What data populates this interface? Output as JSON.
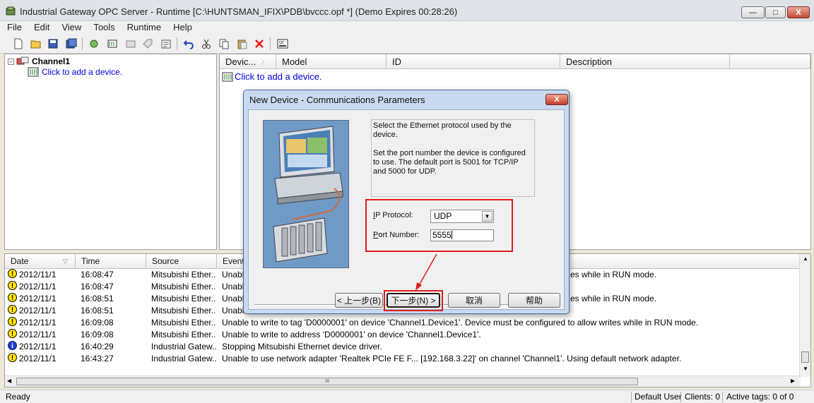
{
  "window": {
    "title": "Industrial Gateway OPC Server - Runtime [C:\\HUNTSMAN_IFIX\\PDB\\bvccc.opf *] (Demo Expires 00:28:26)",
    "min": "—",
    "max": "□",
    "close": "X"
  },
  "menu": [
    "File",
    "Edit",
    "View",
    "Tools",
    "Runtime",
    "Help"
  ],
  "tree": {
    "expander": "−",
    "channel": "Channel1",
    "add_device": "Click to add a device."
  },
  "devices": {
    "columns": [
      "Devic...",
      "Model",
      "ID",
      "Description"
    ],
    "add_device": "Click to add a device."
  },
  "log": {
    "columns": [
      "Date",
      "Time",
      "Source",
      "Event"
    ],
    "rows": [
      {
        "type": "warning",
        "date": "2012/11/1",
        "time": "16:08:47",
        "source": "Mitsubishi Ether...",
        "event": "Unable",
        "event_tail": "es while in RUN mode."
      },
      {
        "type": "warning",
        "date": "2012/11/1",
        "time": "16:08:47",
        "source": "Mitsubishi Ether...",
        "event": "Unable",
        "event_tail": ""
      },
      {
        "type": "warning",
        "date": "2012/11/1",
        "time": "16:08:51",
        "source": "Mitsubishi Ether...",
        "event": "Unable",
        "event_tail": "es while in RUN mode."
      },
      {
        "type": "warning",
        "date": "2012/11/1",
        "time": "16:08:51",
        "source": "Mitsubishi Ether...",
        "event": "Unable",
        "event_tail": ""
      },
      {
        "type": "warning",
        "date": "2012/11/1",
        "time": "16:09:08",
        "source": "Mitsubishi Ether...",
        "event": "Unable to write to tag 'D0000001' on device 'Channel1.Device1'. Device must be configured to allow writes while in RUN mode.",
        "event_tail": ""
      },
      {
        "type": "warning",
        "date": "2012/11/1",
        "time": "16:09:08",
        "source": "Mitsubishi Ether...",
        "event": "Unable to write to address 'D0000001' on device 'Channel1.Device1'.",
        "event_tail": ""
      },
      {
        "type": "info",
        "date": "2012/11/1",
        "time": "16:40:29",
        "source": "Industrial Gatew...",
        "event": "Stopping Mitsubishi Ethernet device driver.",
        "event_tail": ""
      },
      {
        "type": "warning",
        "date": "2012/11/1",
        "time": "16:43:27",
        "source": "Industrial Gatew...",
        "event": "Unable to use network adapter 'Realtek PCIe FE F... [192.168.3.22]' on channel 'Channel1'.  Using default network adapter.",
        "event_tail": ""
      }
    ]
  },
  "status": {
    "ready": "Ready",
    "user": "Default User",
    "clients": "Clients:  0",
    "active_tags": "Active tags:  0 of 0"
  },
  "dialog": {
    "title": "New Device - Communications Parameters",
    "close": "X",
    "info_line1": "Select the Ethernet protocol used by the device.",
    "info_line2": "Set the port number the device is configured to use. The default port is 5001 for TCP/IP and 5000 for UDP.",
    "protocol_label_key": "I",
    "protocol_label_rest": "P Protocol:",
    "protocol_value": "UDP",
    "port_label_key": "P",
    "port_label_rest": "ort Number:",
    "port_value": "5555",
    "buttons": {
      "back": "< 上一步(B)",
      "next": "下一步(N) >",
      "cancel": "取消",
      "help": "帮助"
    }
  },
  "colors": {
    "highlight_red": "#e21d1d",
    "link_blue": "#0000dd",
    "warning_yellow": "#ffe400",
    "info_blue": "#1d3fd0"
  }
}
